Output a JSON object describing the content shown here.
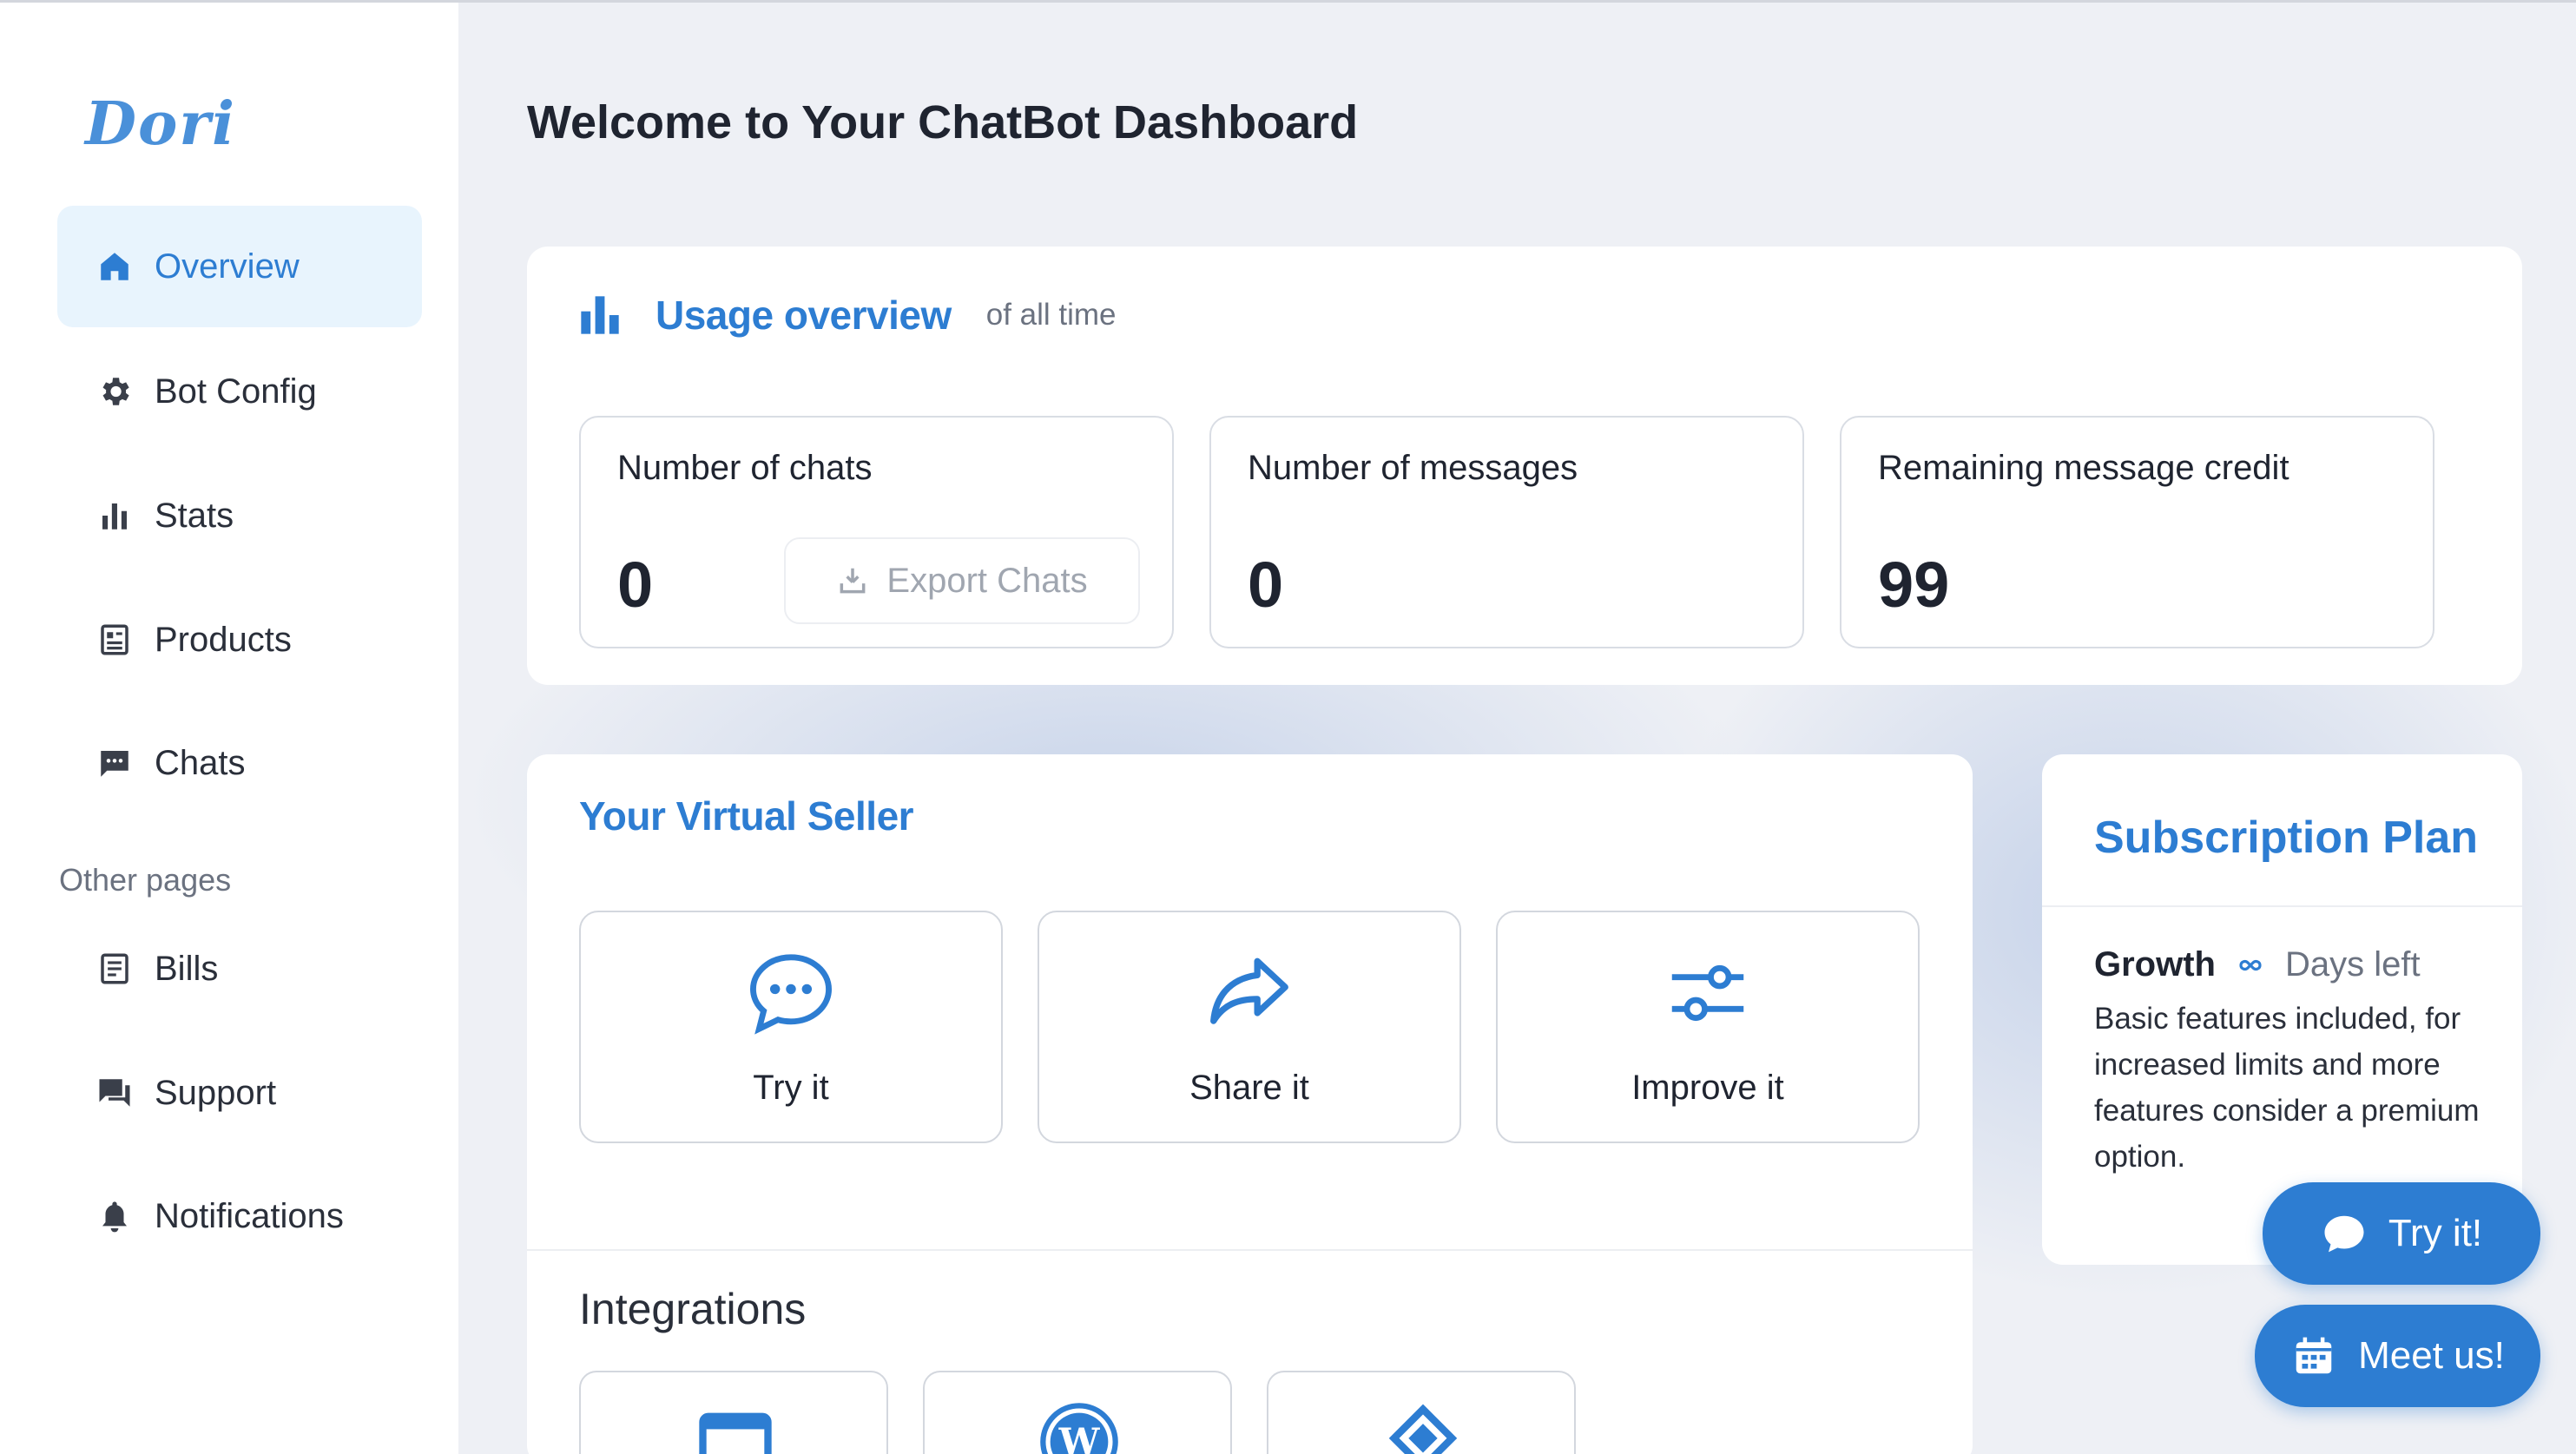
{
  "sidebar": {
    "logo": "Dori",
    "items": [
      {
        "label": "Overview",
        "icon": "home-icon"
      },
      {
        "label": "Bot Config",
        "icon": "gear-icon"
      },
      {
        "label": "Stats",
        "icon": "bar-chart-icon"
      },
      {
        "label": "Products",
        "icon": "document-list-icon"
      },
      {
        "label": "Chats",
        "icon": "chat-bubble-icon"
      }
    ],
    "other_label": "Other pages",
    "other_items": [
      {
        "label": "Bills",
        "icon": "receipt-icon"
      },
      {
        "label": "Support",
        "icon": "support-chat-icon"
      },
      {
        "label": "Notifications",
        "icon": "bell-icon"
      }
    ]
  },
  "page": {
    "title": "Welcome to Your ChatBot Dashboard"
  },
  "usage": {
    "title": "Usage overview",
    "subtitle": "of all time",
    "stats": [
      {
        "label": "Number of chats",
        "value": "0"
      },
      {
        "label": "Number of messages",
        "value": "0"
      },
      {
        "label": "Remaining message credit",
        "value": "99"
      }
    ],
    "export_label": "Export Chats"
  },
  "seller": {
    "title": "Your Virtual Seller",
    "actions": [
      {
        "label": "Try it",
        "icon": "chat-dots-icon"
      },
      {
        "label": "Share it",
        "icon": "share-arrow-icon"
      },
      {
        "label": "Improve it",
        "icon": "sliders-icon"
      }
    ],
    "integrations_title": "Integrations",
    "integrations": [
      "window-icon",
      "wordpress-icon",
      "diamond-icon"
    ]
  },
  "subscription": {
    "title": "Subscription Plan",
    "plan": "Growth",
    "days_label": "Days left",
    "description": "Basic features included, for increased limits and more features consider a premium option."
  },
  "floating": {
    "try_label": "Try it!",
    "meet_label": "Meet us!"
  },
  "colors": {
    "accent": "#2d7dd2",
    "active_bg": "#e8f4fd",
    "page_bg": "#eef0f5"
  }
}
